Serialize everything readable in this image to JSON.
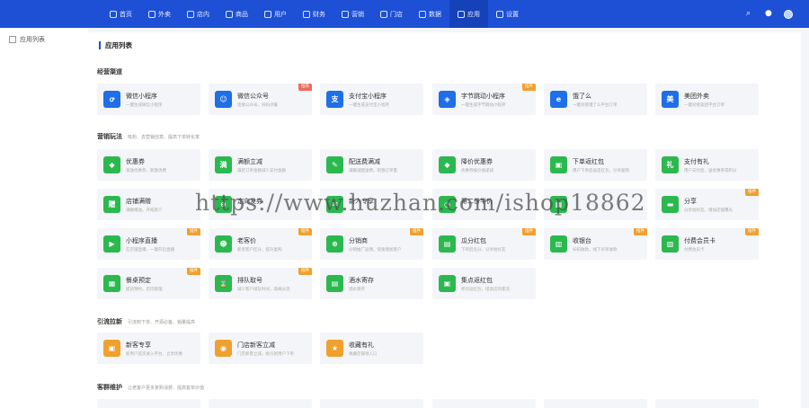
{
  "nav": [
    {
      "label": "首页",
      "icon": "home-icon"
    },
    {
      "label": "外卖",
      "icon": "delivery-icon"
    },
    {
      "label": "店内",
      "icon": "store-icon"
    },
    {
      "label": "商品",
      "icon": "goods-icon"
    },
    {
      "label": "用户",
      "icon": "user-icon"
    },
    {
      "label": "财务",
      "icon": "finance-icon"
    },
    {
      "label": "营销",
      "icon": "marketing-icon"
    },
    {
      "label": "门店",
      "icon": "shop-icon"
    },
    {
      "label": "数据",
      "icon": "data-icon"
    },
    {
      "label": "应用",
      "icon": "apps-icon"
    },
    {
      "label": "设置",
      "icon": "settings-icon"
    }
  ],
  "sidebar": {
    "item": "应用列表"
  },
  "page_title": "应用列表",
  "sections": {
    "s1": {
      "title": "经营渠道",
      "sub": ""
    },
    "s2": {
      "title": "营销玩法",
      "sub": "吸粉、去营销创意、提高下单转化率"
    },
    "s3": {
      "title": "引流拉新",
      "sub": "引流到下单、开源必备、销量提高"
    },
    "s4": {
      "title": "客群维护",
      "sub": "让老客户更多复购消费、提高客单价值"
    }
  },
  "cards": [
    {
      "title": "微信小程序",
      "desc": "一键生成微信小程序",
      "color": "#1e6fe8",
      "glyph": "ꝍ",
      "tag": ""
    },
    {
      "title": "微信公众号",
      "desc": "连接公众号，扫码点餐",
      "color": "#1e6fe8",
      "glyph": "☺",
      "tag": "推荐"
    },
    {
      "title": "支付宝小程序",
      "desc": "一键生成支付宝小程序",
      "color": "#1e6fe8",
      "glyph": "支",
      "tag": ""
    },
    {
      "title": "字节跳动小程序",
      "desc": "一键生成字节跳动小程序",
      "color": "#1e6fe8",
      "glyph": "◈",
      "tag": "插件"
    },
    {
      "title": "饿了么",
      "desc": "一键对接饿了么平台订单",
      "color": "#1e6fe8",
      "glyph": "e",
      "tag": ""
    },
    {
      "title": "美团外卖",
      "desc": "一键对接美团平台订单",
      "color": "#1e6fe8",
      "glyph": "美",
      "tag": ""
    },
    {
      "title": "优惠券",
      "desc": "发放优惠券，刺激消费",
      "color": "#2bb94f",
      "glyph": "◆",
      "tag": ""
    },
    {
      "title": "满额立减",
      "desc": "满足订单金额减少支付金额",
      "color": "#2bb94f",
      "glyph": "满",
      "tag": ""
    },
    {
      "title": "配送费满减",
      "desc": "满额减配送费，刺激订单量",
      "color": "#2bb94f",
      "glyph": "✎",
      "tag": ""
    },
    {
      "title": "降价优惠券",
      "desc": "优惠券按价值递减",
      "color": "#2bb94f",
      "glyph": "◆",
      "tag": ""
    },
    {
      "title": "下单返红包",
      "desc": "用户下单后返还红包，引导复购",
      "color": "#2bb94f",
      "glyph": "▣",
      "tag": ""
    },
    {
      "title": "支付有礼",
      "desc": "用户支付后，送优惠券或积分",
      "color": "#2bb94f",
      "glyph": "礼",
      "tag": ""
    },
    {
      "title": "店铺满赠",
      "desc": "满额赠送，开拓客户",
      "color": "#2bb94f",
      "glyph": "赠",
      "tag": ""
    },
    {
      "title": "定向发券",
      "desc": "",
      "color": "#2bb94f",
      "glyph": "⊕",
      "tag": ""
    },
    {
      "title": "新人专享",
      "desc": "",
      "color": "#2bb94f",
      "glyph": "✉",
      "tag": ""
    },
    {
      "title": "第二份半价",
      "desc": "",
      "color": "#2bb94f",
      "glyph": "◔",
      "tag": ""
    },
    {
      "title": "",
      "desc": "",
      "color": "#2bb94f",
      "glyph": "▦",
      "tag": ""
    },
    {
      "title": "分享",
      "desc": "分享给好友，增加店铺曝光",
      "color": "#2bb94f",
      "glyph": "▬",
      "tag": "插件"
    },
    {
      "title": "小程序直播",
      "desc": "在店铺直播，一键开启直播",
      "color": "#2bb94f",
      "glyph": "▶",
      "tag": "插件"
    },
    {
      "title": "老客价",
      "desc": "新老客户区分，提升复购",
      "color": "#2bb94f",
      "glyph": "☻",
      "tag": "插件"
    },
    {
      "title": "分销商",
      "desc": "分销推广返佣，快速增加客户",
      "color": "#2bb94f",
      "glyph": "⊛",
      "tag": "插件"
    },
    {
      "title": "瓜分红包",
      "desc": "下单后瓜分，分享给好友",
      "color": "#2bb94f",
      "glyph": "▤",
      "tag": "插件"
    },
    {
      "title": "收银台",
      "desc": "扫码收款，线下买单收款",
      "color": "#2bb94f",
      "glyph": "▥",
      "tag": "插件"
    },
    {
      "title": "付费会员卡",
      "desc": "付费会员卡",
      "color": "#2bb94f",
      "glyph": "▧",
      "tag": "插件"
    },
    {
      "title": "餐桌预定",
      "desc": "提前预约，店内管理",
      "color": "#2bb94f",
      "glyph": "▦",
      "tag": "插件"
    },
    {
      "title": "排队取号",
      "desc": "减少客户排队时间，高峰分流",
      "color": "#2bb94f",
      "glyph": "⌛",
      "tag": "插件"
    },
    {
      "title": "酒水寄存",
      "desc": "酒水寄存",
      "color": "#2bb94f",
      "glyph": "▤",
      "tag": ""
    },
    {
      "title": "集点返红包",
      "desc": "积点返红包，提高店内客流",
      "color": "#2bb94f",
      "glyph": "▣",
      "tag": ""
    },
    {
      "title": "新客专享",
      "desc": "新用户首次进入平台，立享优惠",
      "color": "#f0a02e",
      "glyph": "▣",
      "tag": ""
    },
    {
      "title": "门店新客立减",
      "desc": "门店新客立减，吸引新用户下单",
      "color": "#f0a02e",
      "glyph": "◉",
      "tag": ""
    },
    {
      "title": "收藏有礼",
      "desc": "收藏店铺领入口",
      "color": "#f0a02e",
      "glyph": "★",
      "tag": ""
    }
  ],
  "watermark": "https://www.huzhan.com/ishop18862",
  "colors": {
    "topbar": "#1e50d6",
    "blue": "#1e6fe8",
    "green": "#2bb94f",
    "orange": "#f0a02e",
    "tag_red": "#f06a5a",
    "tag_orange": "#f0a02e"
  }
}
